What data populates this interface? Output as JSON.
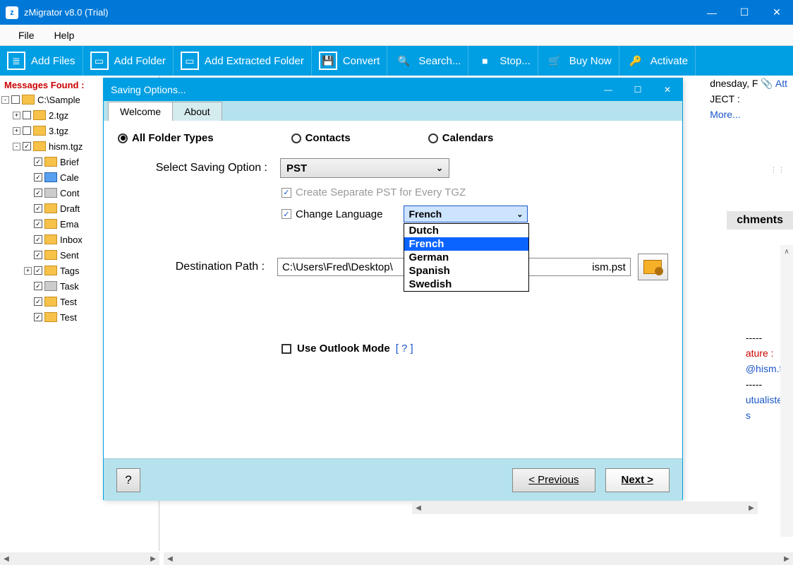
{
  "window": {
    "title": "zMigrator v8.0 (Trial)"
  },
  "menubar": {
    "file": "File",
    "help": "Help"
  },
  "toolbar": {
    "addfiles": "Add Files",
    "addfolder": "Add Folder",
    "addextracted": "Add Extracted Folder",
    "convert": "Convert",
    "search": "Search...",
    "stop": "Stop...",
    "buynow": "Buy Now",
    "activate": "Activate"
  },
  "sidebar": {
    "messages_found": "Messages Found :",
    "items": [
      {
        "indent": 0,
        "exp": "-",
        "checked": "",
        "icon": "folder",
        "label": "C:\\Sample"
      },
      {
        "indent": 1,
        "exp": "+",
        "checked": "",
        "icon": "folder",
        "label": "2.tgz"
      },
      {
        "indent": 1,
        "exp": "+",
        "checked": "",
        "icon": "folder",
        "label": "3.tgz"
      },
      {
        "indent": 1,
        "exp": "-",
        "checked": "✓",
        "icon": "folder",
        "label": "hism.tgz"
      },
      {
        "indent": 2,
        "exp": "",
        "checked": "✓",
        "icon": "folder",
        "label": "Brief"
      },
      {
        "indent": 2,
        "exp": "",
        "checked": "✓",
        "icon": "blue",
        "label": "Cale"
      },
      {
        "indent": 2,
        "exp": "",
        "checked": "✓",
        "icon": "grey",
        "label": "Cont"
      },
      {
        "indent": 2,
        "exp": "",
        "checked": "✓",
        "icon": "folder",
        "label": "Draft"
      },
      {
        "indent": 2,
        "exp": "",
        "checked": "✓",
        "icon": "folder",
        "label": "Ema"
      },
      {
        "indent": 2,
        "exp": "",
        "checked": "✓",
        "icon": "folder",
        "label": "Inbox"
      },
      {
        "indent": 2,
        "exp": "",
        "checked": "✓",
        "icon": "folder",
        "label": "Sent"
      },
      {
        "indent": 2,
        "exp": "+",
        "checked": "✓",
        "icon": "folder",
        "label": "Tags"
      },
      {
        "indent": 2,
        "exp": "",
        "checked": "✓",
        "icon": "grey",
        "label": "Task"
      },
      {
        "indent": 2,
        "exp": "",
        "checked": "✓",
        "icon": "folder",
        "label": "Test"
      },
      {
        "indent": 2,
        "exp": "",
        "checked": "✓",
        "icon": "folder",
        "label": "Test"
      }
    ]
  },
  "dialog": {
    "title": "Saving Options...",
    "tabs": {
      "welcome": "Welcome",
      "about": "About"
    },
    "radios": {
      "all": "All Folder Types",
      "contacts": "Contacts",
      "calendars": "Calendars"
    },
    "select_label": "Select Saving Option :",
    "select_value": "PST",
    "create_separate": "Create Separate PST for Every TGZ",
    "change_language": "Change Language",
    "lang_value": "French",
    "lang_options": [
      "Dutch",
      "French",
      "German",
      "Spanish",
      "Swedish"
    ],
    "dest_label": "Destination Path :",
    "dest_value": "C:\\Users\\Fred\\Desktop\\",
    "dest_tail": "ism.pst",
    "outlook": "Use Outlook Mode",
    "outlook_help": "[ ? ]",
    "footer": {
      "help": "?",
      "prev": "<  Previous",
      "next": "Next >"
    }
  },
  "preview": {
    "day": "dnesday, F",
    "att": "Att",
    "ject": "JECT :",
    "more": "More...",
    "attach_hdr": "chments",
    "dashes": "-----",
    "sig": "ature :",
    "email": "@hism.fr",
    "line2": "utualistes",
    "line3": "s"
  }
}
